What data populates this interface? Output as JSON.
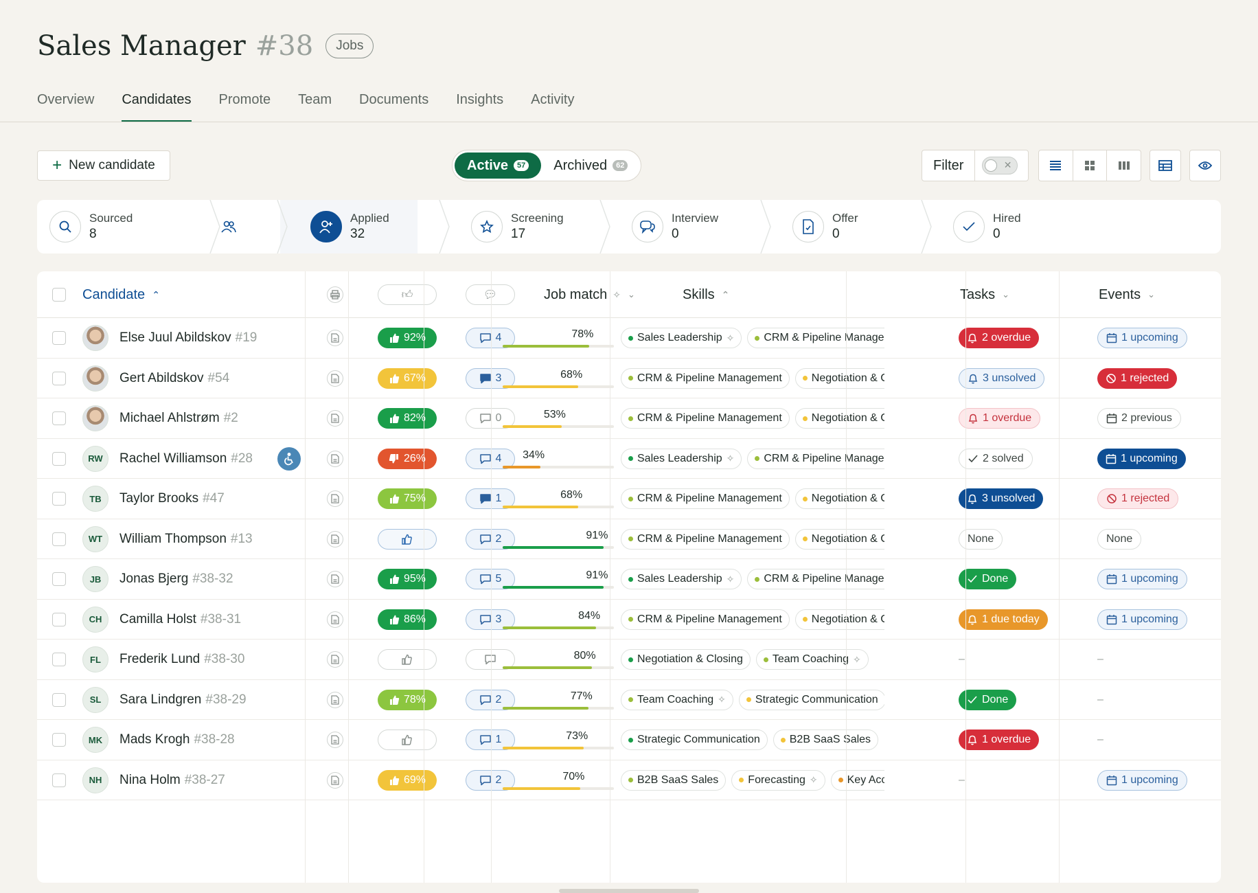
{
  "header": {
    "title": "Sales Manager",
    "number": "#38",
    "badge": "Jobs"
  },
  "tabs": [
    "Overview",
    "Candidates",
    "Promote",
    "Team",
    "Documents",
    "Insights",
    "Activity"
  ],
  "toolbar": {
    "new_candidate": "New candidate",
    "active_label": "Active",
    "active_count": "57",
    "archived_label": "Archived",
    "archived_count": "62",
    "filter_label": "Filter"
  },
  "pipeline": [
    {
      "label": "Sourced",
      "count": "8",
      "icon": "search-icon"
    },
    {
      "label": "",
      "count": "",
      "icon": "people-icon"
    },
    {
      "label": "Applied",
      "count": "32",
      "icon": "add-user-icon"
    },
    {
      "label": "Screening",
      "count": "17",
      "icon": "star-icon"
    },
    {
      "label": "Interview",
      "count": "0",
      "icon": "chat-icon"
    },
    {
      "label": "Offer",
      "count": "0",
      "icon": "document-icon"
    },
    {
      "label": "Hired",
      "count": "0",
      "icon": "check-icon"
    }
  ],
  "columns": {
    "candidate": "Candidate",
    "job_match": "Job match",
    "skills": "Skills",
    "tasks": "Tasks",
    "events": "Events"
  },
  "colors": {
    "green": "#0e6b45",
    "blue": "#0e4e94"
  },
  "rows": [
    {
      "name": "Else Juul Abildskov",
      "num": "#19",
      "avatar": "",
      "photo": true,
      "score": "92%",
      "score_color": "#1a9e4a",
      "comments": "4",
      "cmt_style": "blue",
      "match": "78%",
      "match_val": 78,
      "match_color": "#9bbe3b",
      "skills": [
        [
          "Sales Leadership",
          "#1a9e4a",
          true
        ],
        [
          "CRM & Pipeline Management",
          "#9bbe3b",
          false
        ]
      ],
      "task": "2 overdue",
      "task_style": "p-red",
      "task_icon": "bell",
      "event": "1 upcoming",
      "event_style": "p-blueol",
      "event_icon": "cal"
    },
    {
      "name": "Gert Abildskov",
      "num": "#54",
      "avatar": "",
      "photo": true,
      "score": "67%",
      "score_color": "#f2c43a",
      "comments": "3",
      "cmt_style": "blue",
      "match": "68%",
      "match_val": 68,
      "match_color": "#f2c43a",
      "skills": [
        [
          "CRM & Pipeline Management",
          "#9bbe3b",
          false
        ],
        [
          "Negotiation & Closing",
          "#f2c43a",
          false
        ]
      ],
      "task": "3 unsolved",
      "task_style": "p-blueol",
      "task_icon": "bell",
      "event": "1 rejected",
      "event_style": "p-red",
      "event_icon": "ban"
    },
    {
      "name": "Michael Ahlstrøm",
      "num": "#2",
      "avatar": "",
      "photo": true,
      "score": "82%",
      "score_color": "#1a9e4a",
      "comments": "0",
      "cmt_style": "grey",
      "match": "53%",
      "match_val": 53,
      "match_color": "#f2c43a",
      "skills": [
        [
          "CRM & Pipeline Management",
          "#9bbe3b",
          false
        ],
        [
          "Negotiation & Closing",
          "#f2c43a",
          false
        ]
      ],
      "task": "1 overdue",
      "task_style": "p-redl",
      "task_icon": "bell",
      "event": "2 previous",
      "event_style": "p-grey",
      "event_icon": "cal"
    },
    {
      "name": "Rachel Williamson",
      "num": "#28",
      "avatar": "RW",
      "photo": false,
      "access": true,
      "score": "26%",
      "score_color": "#e2552e",
      "comments": "4",
      "cmt_style": "blue",
      "match": "34%",
      "match_val": 34,
      "match_color": "#e8972a",
      "skills": [
        [
          "Sales Leadership",
          "#1a9e4a",
          true
        ],
        [
          "CRM & Pipeline Management",
          "#9bbe3b",
          false
        ]
      ],
      "task": "2 solved",
      "task_style": "p-grey",
      "task_icon": "check",
      "event": "1 upcoming",
      "event_style": "p-blue",
      "event_icon": "cal"
    },
    {
      "name": "Taylor Brooks",
      "num": "#47",
      "avatar": "TB",
      "photo": false,
      "score": "75%",
      "score_color": "#8cc63f",
      "comments": "1",
      "cmt_style": "blue",
      "match": "68%",
      "match_val": 68,
      "match_color": "#f2c43a",
      "skills": [
        [
          "CRM & Pipeline Management",
          "#9bbe3b",
          false
        ],
        [
          "Negotiation & Closing",
          "#f2c43a",
          false
        ]
      ],
      "task": "3 unsolved",
      "task_style": "p-blue",
      "task_icon": "bell",
      "event": "1 rejected",
      "event_style": "p-redl",
      "event_icon": "ban"
    },
    {
      "name": "William Thompson",
      "num": "#13",
      "avatar": "WT",
      "photo": false,
      "score": "",
      "score_color": "blue",
      "comments": "2",
      "cmt_style": "blue",
      "match": "91%",
      "match_val": 91,
      "match_color": "#1a9e4a",
      "skills": [
        [
          "CRM & Pipeline Management",
          "#9bbe3b",
          false
        ],
        [
          "Negotiation & Closing",
          "#f2c43a",
          false
        ]
      ],
      "task": "None",
      "task_style": "p-grey",
      "task_icon": "",
      "event": "None",
      "event_style": "p-grey",
      "event_icon": ""
    },
    {
      "name": "Jonas Bjerg",
      "num": "#38-32",
      "avatar": "JB",
      "photo": false,
      "score": "95%",
      "score_color": "#1a9e4a",
      "comments": "5",
      "cmt_style": "blue",
      "match": "91%",
      "match_val": 91,
      "match_color": "#1a9e4a",
      "skills": [
        [
          "Sales Leadership",
          "#1a9e4a",
          true
        ],
        [
          "CRM & Pipeline Management",
          "#9bbe3b",
          false
        ]
      ],
      "task": "Done",
      "task_style": "p-green",
      "task_icon": "check",
      "event": "1 upcoming",
      "event_style": "p-blueol",
      "event_icon": "cal"
    },
    {
      "name": "Camilla Holst",
      "num": "#38-31",
      "avatar": "CH",
      "photo": false,
      "score": "86%",
      "score_color": "#1a9e4a",
      "comments": "3",
      "cmt_style": "blue",
      "match": "84%",
      "match_val": 84,
      "match_color": "#9bbe3b",
      "skills": [
        [
          "CRM & Pipeline Management",
          "#9bbe3b",
          false
        ],
        [
          "Negotiation & Closing",
          "#f2c43a",
          false
        ]
      ],
      "task": "1 due today",
      "task_style": "p-orange",
      "task_icon": "bell",
      "event": "1 upcoming",
      "event_style": "p-blueol",
      "event_icon": "cal"
    },
    {
      "name": "Frederik Lund",
      "num": "#38-30",
      "avatar": "FL",
      "photo": false,
      "score": "",
      "score_color": "grey",
      "comments": "",
      "cmt_style": "grey",
      "match": "80%",
      "match_val": 80,
      "match_color": "#9bbe3b",
      "skills": [
        [
          "Negotiation & Closing",
          "#1a9e4a",
          false
        ],
        [
          "Team Coaching",
          "#9bbe3b",
          true
        ]
      ],
      "task": "–",
      "task_style": "dash",
      "task_icon": "",
      "event": "–",
      "event_style": "dash",
      "event_icon": ""
    },
    {
      "name": "Sara Lindgren",
      "num": "#38-29",
      "avatar": "SL",
      "photo": false,
      "score": "78%",
      "score_color": "#8cc63f",
      "comments": "2",
      "cmt_style": "blue",
      "match": "77%",
      "match_val": 77,
      "match_color": "#9bbe3b",
      "skills": [
        [
          "Team Coaching",
          "#9bbe3b",
          true
        ],
        [
          "Strategic Communication",
          "#f2c43a",
          false
        ]
      ],
      "task": "Done",
      "task_style": "p-green",
      "task_icon": "check",
      "event": "–",
      "event_style": "dash",
      "event_icon": ""
    },
    {
      "name": "Mads Krogh",
      "num": "#38-28",
      "avatar": "MK",
      "photo": false,
      "score": "",
      "score_color": "grey",
      "comments": "1",
      "cmt_style": "blue",
      "match": "73%",
      "match_val": 73,
      "match_color": "#f2c43a",
      "skills": [
        [
          "Strategic Communication",
          "#1a9e4a",
          false
        ],
        [
          "B2B SaaS Sales",
          "#f2c43a",
          false
        ]
      ],
      "task": "1 overdue",
      "task_style": "p-red",
      "task_icon": "bell",
      "event": "–",
      "event_style": "dash",
      "event_icon": ""
    },
    {
      "name": "Nina Holm",
      "num": "#38-27",
      "avatar": "NH",
      "photo": false,
      "score": "69%",
      "score_color": "#f2c43a",
      "comments": "2",
      "cmt_style": "blue",
      "match": "70%",
      "match_val": 70,
      "match_color": "#f2c43a",
      "skills": [
        [
          "B2B SaaS Sales",
          "#9bbe3b",
          false
        ],
        [
          "Forecasting",
          "#f2c43a",
          true
        ],
        [
          "Key Account",
          "#e8972a",
          false
        ]
      ],
      "task": "–",
      "task_style": "dash",
      "task_icon": "",
      "event": "1 upcoming",
      "event_style": "p-blueol",
      "event_icon": "cal"
    }
  ]
}
